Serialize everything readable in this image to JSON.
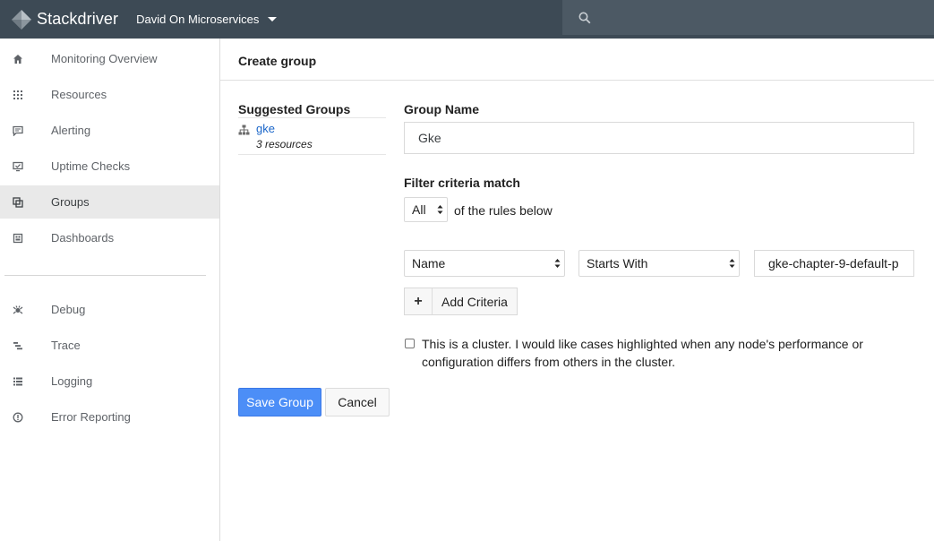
{
  "app": {
    "name": "Stackdriver",
    "project": "David On Microservices"
  },
  "sidebar": {
    "items": [
      {
        "label": "Monitoring Overview",
        "icon": "home-icon"
      },
      {
        "label": "Resources",
        "icon": "grid-icon"
      },
      {
        "label": "Alerting",
        "icon": "alert-icon"
      },
      {
        "label": "Uptime Checks",
        "icon": "monitor-icon"
      },
      {
        "label": "Groups",
        "icon": "groups-icon",
        "active": true
      },
      {
        "label": "Dashboards",
        "icon": "dashboard-icon"
      },
      {
        "label": "Debug",
        "icon": "debug-icon"
      },
      {
        "label": "Trace",
        "icon": "trace-icon"
      },
      {
        "label": "Logging",
        "icon": "logging-icon"
      },
      {
        "label": "Error Reporting",
        "icon": "error-reporting-icon"
      }
    ]
  },
  "page": {
    "title": "Create group"
  },
  "suggested": {
    "title": "Suggested Groups",
    "items": [
      {
        "name": "gke",
        "count": "3 resources"
      }
    ]
  },
  "form": {
    "group_name_label": "Group Name",
    "group_name_value": "Gke",
    "filter_label": "Filter criteria match",
    "match_value": "All",
    "match_suffix": "of the rules below",
    "criteria": {
      "field": "Name",
      "operator": "Starts With",
      "value": "gke-chapter-9-default-p"
    },
    "add_criteria_label": "Add Criteria",
    "cluster_checkbox_checked": false,
    "cluster_text": "This is a cluster. I would like cases highlighted when any node's performance or configuration differs from others in the cluster.",
    "save_label": "Save Group",
    "cancel_label": "Cancel"
  },
  "colors": {
    "topbar": "#3d4a55",
    "primary_button": "#4c8ef7",
    "link": "#1a66c9",
    "active_nav": "#e9e9e9"
  }
}
